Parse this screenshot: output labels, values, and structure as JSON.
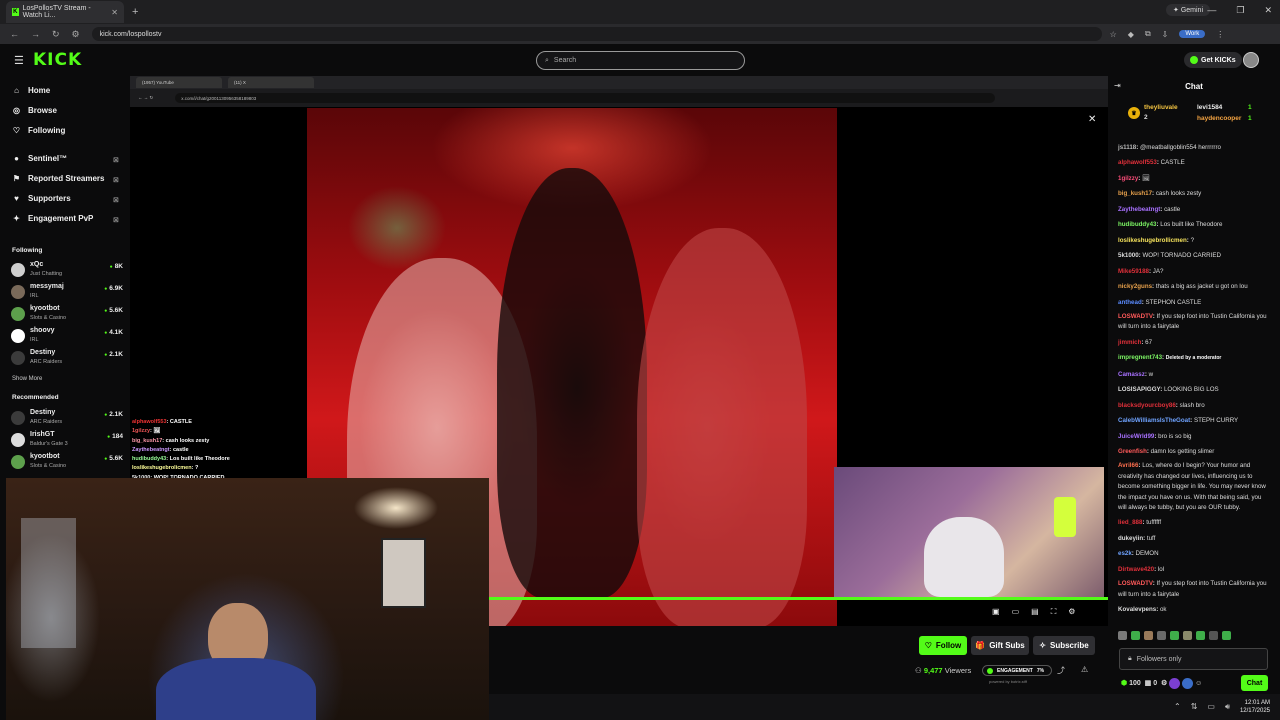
{
  "browser": {
    "tab_title": "LosPollosTV Stream - Watch Li...",
    "gemini": "✦ Gemini",
    "url": "kick.com/lospollostv",
    "profile": "Work"
  },
  "kick": {
    "logo": "KICK",
    "search_placeholder": "Search",
    "get_kicks": "Get KICKs"
  },
  "sidebar": {
    "nav": [
      {
        "label": "Home",
        "icon": "home-icon"
      },
      {
        "label": "Browse",
        "icon": "browse-icon"
      },
      {
        "label": "Following",
        "icon": "heart-icon"
      }
    ],
    "extensions": [
      {
        "label": "Sentinel™"
      },
      {
        "label": "Reported Streamers"
      },
      {
        "label": "Supporters"
      },
      {
        "label": "Engagement PvP"
      }
    ],
    "following_title": "Following",
    "following": [
      {
        "name": "xQc",
        "category": "Just Chatting",
        "viewers": "8K",
        "color": "#cfcfcf"
      },
      {
        "name": "messymaj",
        "category": "IRL",
        "viewers": "6.9K",
        "color": "#7a6a5a"
      },
      {
        "name": "kyootbot",
        "category": "Slots & Casino",
        "viewers": "5.6K",
        "color": "#5da04c"
      },
      {
        "name": "shoovy",
        "category": "IRL",
        "viewers": "4.1K",
        "color": "#ffffff"
      },
      {
        "name": "Destiny",
        "category": "ARC Raiders",
        "viewers": "2.1K",
        "color": "#3b3b3b"
      }
    ],
    "show_more": "Show More",
    "recommended_title": "Recommended",
    "recommended": [
      {
        "name": "Destiny",
        "category": "ARC Raiders",
        "viewers": "2.1K",
        "color": "#3b3b3b"
      },
      {
        "name": "IrishGT",
        "category": "Baldur's Gate 3",
        "viewers": "184",
        "color": "#dddddd"
      },
      {
        "name": "kyootbot",
        "category": "Slots & Casino",
        "viewers": "5.6K",
        "color": "#5da04c"
      }
    ]
  },
  "stream": {
    "inner_tab1": "(1957) YouTube",
    "inner_tab2": "(11) X",
    "inner_url": "x.com/i/chat/g2001130956358189803",
    "overlay_chat": [
      {
        "user": "alphawolf553",
        "text": "CASTLE",
        "cls": "u1"
      },
      {
        "user": "1gilzzy",
        "text": "🖼",
        "cls": "u2"
      },
      {
        "user": "big_kush17",
        "text": "cash looks zesty",
        "cls": "u3"
      },
      {
        "user": "Zaythebeatngt",
        "text": "castle",
        "cls": "u4"
      },
      {
        "user": "hudibuddy43",
        "text": "Los built like Theodore",
        "cls": "u5"
      },
      {
        "user": "loslikeshugebrolicmen",
        "text": "?",
        "cls": "u6"
      },
      {
        "user": "5k1000",
        "text": "WOP! TORNADO CARRIED",
        "cls": "u7"
      }
    ]
  },
  "actions": {
    "follow": "Follow",
    "gift_subs": "Gift Subs",
    "subscribe": "Subscribe",
    "viewers_count": "9,477",
    "viewers_label": "Viewers",
    "engagement_label": "ENGAGEMENT",
    "engagement_value": "7%",
    "powered_by": "powered by botrix.stff"
  },
  "chat": {
    "title": "Chat",
    "leaders": [
      {
        "name": "theyliuvale",
        "count": "2"
      },
      {
        "name": "levi1584",
        "count": "1"
      },
      {
        "name": "haydencooper",
        "count": "1"
      }
    ],
    "messages": [
      {
        "user": "js1118",
        "text": "@meatballgoblin554 herrrrrro",
        "color": "#bbbbbb"
      },
      {
        "user": "alphawolf553",
        "text": "CASTLE",
        "color": "#e0303a"
      },
      {
        "user": "1gilzzy",
        "text": "🖼",
        "color": "#ff4e7a"
      },
      {
        "user": "big_kush17",
        "text": "cash looks zesty",
        "color": "#e9a24c"
      },
      {
        "user": "Zaythebeatngt",
        "text": "castle",
        "color": "#a871ff"
      },
      {
        "user": "hudibuddy43",
        "text": "Los built like Theodore",
        "color": "#7cf564"
      },
      {
        "user": "loslikeshugebrollicmen",
        "text": "?",
        "color": "#f5e25c"
      },
      {
        "user": "5k1000",
        "text": "WOP! TORNADO CARRIED",
        "color": "#dddddd"
      },
      {
        "user": "Mike59188",
        "text": "JA?",
        "color": "#e0303a"
      },
      {
        "user": "nicky2guns",
        "text": "thats a big ass jacket u got on lou",
        "color": "#e9a24c"
      },
      {
        "user": "anthead",
        "text": "STEPHON CASTLE",
        "color": "#5a8bff"
      },
      {
        "user": "LOSWADTV",
        "text": "If you step foot into Tustin California you will turn into a fairytale",
        "color": "#ff5a5a"
      },
      {
        "user": "jimmich",
        "text": "67",
        "color": "#e0303a"
      },
      {
        "user": "impregnent743",
        "text": "Deleted by a moderator",
        "color": "#7cf564"
      },
      {
        "user": "Camassz",
        "text": "w",
        "color": "#a871ff"
      },
      {
        "user": "LOSISAPIGGY",
        "text": "LOOKING BIG LOS",
        "color": "#dddddd"
      },
      {
        "user": "blacksdyourcboy86",
        "text": "slash bro",
        "color": "#e0303a"
      },
      {
        "user": "CalebWilliamsIsTheGoat",
        "text": "STEPH CURRY",
        "color": "#6fa3ff"
      },
      {
        "user": "JuiceWrld99",
        "text": "bro is so big",
        "color": "#a871ff"
      },
      {
        "user": "Greenfish",
        "text": "damn los getting slimer",
        "color": "#ff5a5a"
      },
      {
        "user": "Avril66",
        "text": "Los, where do I begin? Your humor and creativity has changed our lives, influencing us to become something bigger in life. You may never know the impact you have on us. With that being said, you will always be tubby, but you are OUR tubby.",
        "color": "#ff6f4e"
      },
      {
        "user": "lied_888",
        "text": "tuffffff",
        "color": "#e0303a"
      },
      {
        "user": "dukeyiin",
        "text": "tuff",
        "color": "#dddddd"
      },
      {
        "user": "es2k",
        "text": "DEMON",
        "color": "#6fa3ff"
      },
      {
        "user": "Dirtwave420",
        "text": "lol",
        "color": "#e0303a"
      },
      {
        "user": "LOSWADTV",
        "text": "If you step foot into Tustin California you will turn into a fairytale",
        "color": "#ff5a5a"
      },
      {
        "user": "Kovalevpens",
        "text": "ok",
        "color": "#dddddd"
      }
    ],
    "followers_only": "Followers only",
    "points": "100",
    "zero": "0",
    "send": "Chat"
  },
  "taskbar": {
    "time": "12:01 AM",
    "date": "12/17/2025"
  }
}
